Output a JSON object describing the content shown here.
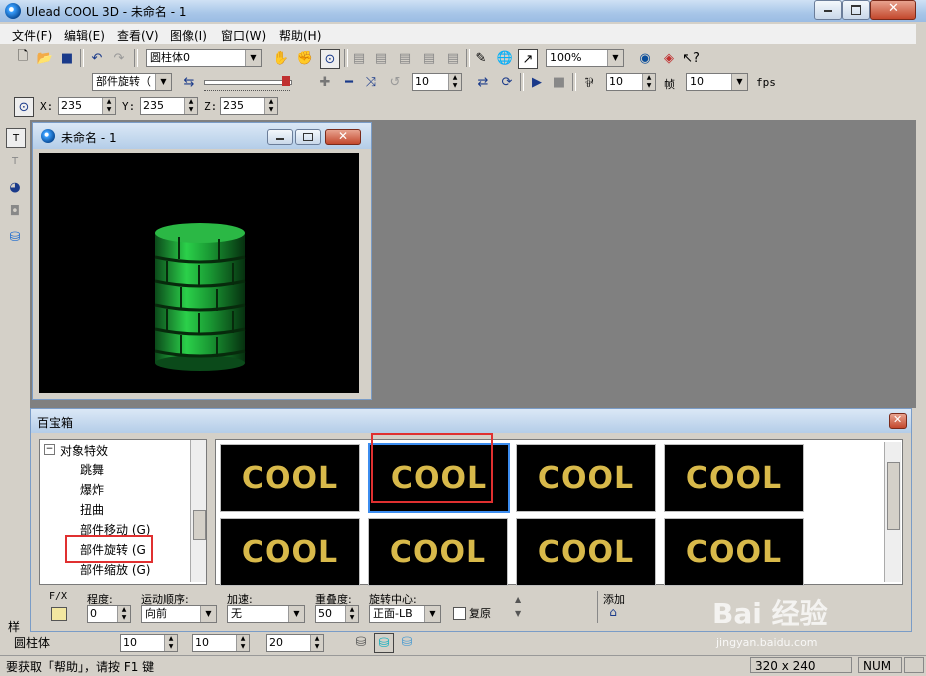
{
  "window": {
    "title": "Ulead COOL 3D - 未命名 - 1"
  },
  "menu": [
    "文件(F)",
    "编辑(E)",
    "查看(V)",
    "图像(I)",
    "窗口(W)",
    "帮助(H)"
  ],
  "toolbar1": {
    "object_combo": "圆柱体0",
    "zoom_combo": "100%"
  },
  "toolbar2": {
    "effect_combo": "部件旋转（",
    "frame_value": "10",
    "speed_value": "10",
    "frame_label": "帧",
    "fps_combo": "10",
    "fps_label": "fps"
  },
  "toolbar3": {
    "x_label": "X:",
    "x_value": "235",
    "y_label": "Y:",
    "y_value": "235",
    "z_label": "Z:",
    "z_value": "235"
  },
  "document": {
    "title": "未命名 - 1"
  },
  "panel": {
    "title": "百宝箱",
    "tree": [
      {
        "label": "对象特效",
        "expander": "−"
      },
      {
        "label": "跳舞"
      },
      {
        "label": "爆炸"
      },
      {
        "label": "扭曲"
      },
      {
        "label": "部件移动 (G)"
      },
      {
        "label": "部件旋转 (G"
      },
      {
        "label": "部件缩放 (G)"
      }
    ],
    "thumbnails": [
      "COOL",
      "COOL",
      "COOL",
      "COOL",
      "COOL",
      "COOL",
      "COOL",
      "COOL"
    ],
    "fx_label": "F/X",
    "controls": {
      "degree_label": "程度:",
      "degree_value": "0",
      "order_label": "运动顺序:",
      "order_value": "向前",
      "accel_label": "加速:",
      "accel_value": "无",
      "overlap_label": "重叠度:",
      "overlap_value": "50",
      "center_label": "旋转中心:",
      "center_value": "正面-LB",
      "reset_label": "复原",
      "add_label": "添加"
    }
  },
  "bottom_toolbar": {
    "tab1": "样",
    "object_name": "圆柱体",
    "v1": "10",
    "v2": "10",
    "v3": "20"
  },
  "status": {
    "help": "要获取「帮助」，请按 F1 键",
    "size": "320 x 240",
    "num": "NUM"
  },
  "watermark": {
    "brand": "Bai 经验",
    "url": "jingyan.baidu.com"
  }
}
